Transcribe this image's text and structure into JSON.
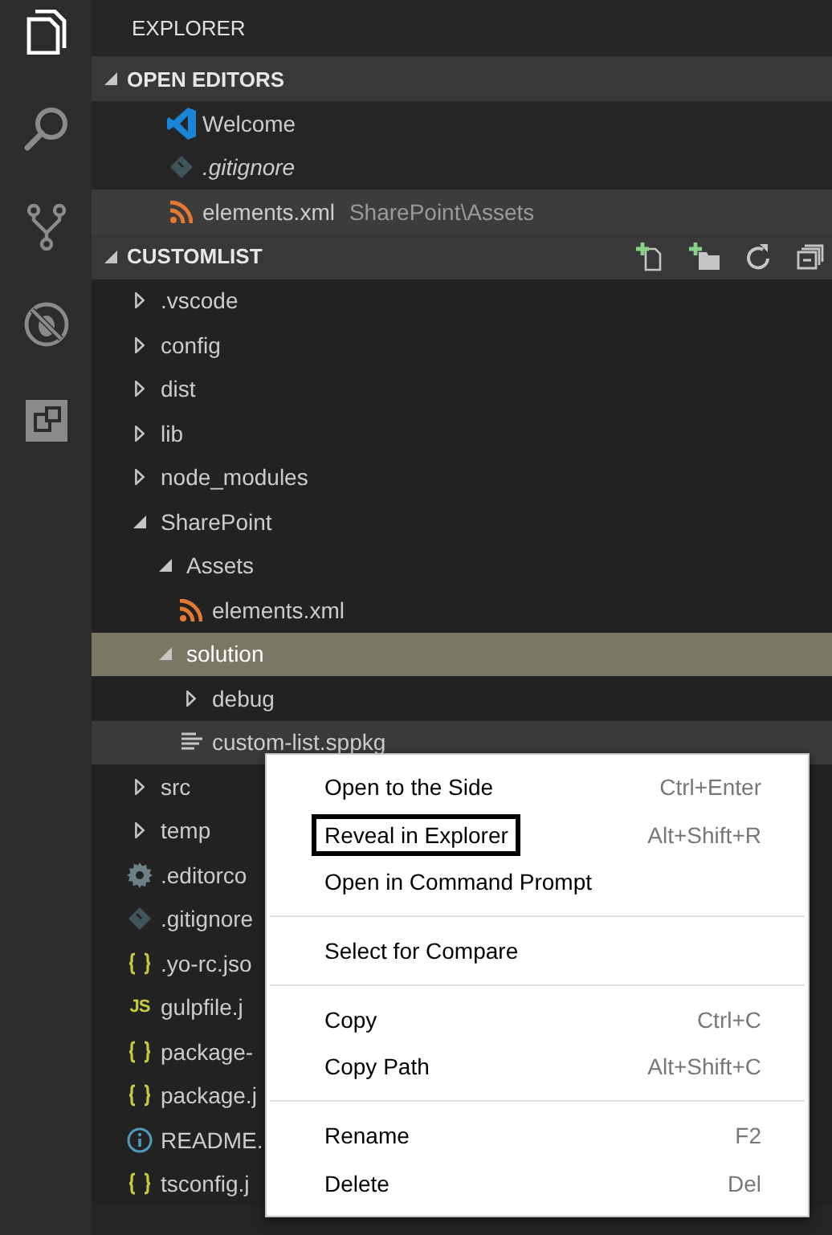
{
  "activity_bar": [
    {
      "kind": "files",
      "selected": true
    },
    {
      "kind": "search",
      "selected": false
    },
    {
      "kind": "scm",
      "selected": false
    },
    {
      "kind": "debug",
      "selected": false
    },
    {
      "kind": "extensions",
      "selected": false
    }
  ],
  "sidebar": {
    "title": "EXPLORER",
    "open_editors": {
      "title": "OPEN EDITORS",
      "expanded": true,
      "items": [
        {
          "kind": "vscode",
          "name": "Welcome",
          "preview": false,
          "selected": false
        },
        {
          "kind": "git",
          "name": ".gitignore",
          "preview": true,
          "selected": false
        },
        {
          "kind": "rss",
          "name": "elements.xml",
          "description": "SharePoint\\Assets",
          "preview": false,
          "selected": true
        }
      ]
    },
    "folder": {
      "title": "CUSTOMLIST",
      "expanded": true,
      "tree": [
        {
          "kind": "folder",
          "name": ".vscode",
          "expanded": false,
          "selected": false,
          "hovered": false
        },
        {
          "kind": "folder",
          "name": "config",
          "expanded": false,
          "selected": false,
          "hovered": false
        },
        {
          "kind": "folder",
          "name": "dist",
          "expanded": false,
          "selected": false,
          "hovered": false
        },
        {
          "kind": "folder",
          "name": "lib",
          "expanded": false,
          "selected": false,
          "hovered": false
        },
        {
          "kind": "folder",
          "name": "node_modules",
          "expanded": false,
          "selected": false,
          "hovered": false
        },
        {
          "kind": "folder",
          "name": "SharePoint",
          "expanded": true,
          "selected": false,
          "hovered": false,
          "children": [
            {
              "kind": "folder",
              "name": "Assets",
              "expanded": true,
              "selected": false,
              "hovered": false,
              "children": [
                {
                  "kind": "rss",
                  "name": "elements.xml",
                  "selected": false,
                  "hovered": false
                }
              ]
            },
            {
              "kind": "folder",
              "name": "solution",
              "expanded": true,
              "selected": true,
              "hovered": false,
              "children": [
                {
                  "kind": "folder",
                  "name": "debug",
                  "expanded": false,
                  "selected": false,
                  "hovered": false
                },
                {
                  "kind": "text",
                  "name": "custom-list.sppkg",
                  "selected": false,
                  "hovered": true
                }
              ]
            }
          ]
        },
        {
          "kind": "folder",
          "name": "src",
          "expanded": false,
          "selected": false,
          "hovered": false
        },
        {
          "kind": "folder",
          "name": "temp",
          "expanded": false,
          "selected": false,
          "hovered": false
        },
        {
          "kind": "settings",
          "name": ".editorco",
          "selected": false,
          "hovered": false
        },
        {
          "kind": "git",
          "name": ".gitignore",
          "selected": false,
          "hovered": false
        },
        {
          "kind": "json",
          "name": ".yo-rc.jso",
          "selected": false,
          "hovered": false
        },
        {
          "kind": "js",
          "icon_label": "JS",
          "name": "gulpfile.j",
          "selected": false,
          "hovered": false
        },
        {
          "kind": "json",
          "name": "package-",
          "selected": false,
          "hovered": false
        },
        {
          "kind": "json",
          "name": "package.j",
          "selected": false,
          "hovered": false
        },
        {
          "kind": "info",
          "name": "README.",
          "selected": false,
          "hovered": false
        },
        {
          "kind": "json",
          "name": "tsconfig.j",
          "selected": false,
          "hovered": false
        }
      ]
    }
  },
  "context_menu": {
    "groups": [
      [
        {
          "label": "Open to the Side",
          "shortcut": "Ctrl+Enter",
          "focused": false
        },
        {
          "label": "Reveal in Explorer",
          "shortcut": "Alt+Shift+R",
          "focused": true
        },
        {
          "label": "Open in Command Prompt",
          "focused": false
        }
      ],
      [
        {
          "label": "Select for Compare",
          "focused": false
        }
      ],
      [
        {
          "label": "Copy",
          "shortcut": "Ctrl+C",
          "focused": false
        },
        {
          "label": "Copy Path",
          "shortcut": "Alt+Shift+C",
          "focused": false
        }
      ],
      [
        {
          "label": "Rename",
          "shortcut": "F2",
          "focused": false
        },
        {
          "label": "Delete",
          "shortcut": "Del",
          "focused": false
        }
      ]
    ]
  }
}
